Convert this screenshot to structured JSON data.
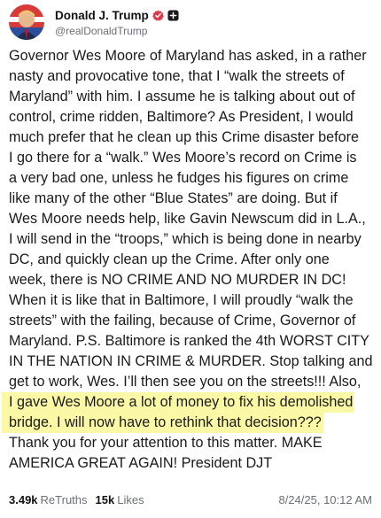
{
  "author": {
    "display_name": "Donald J. Trump",
    "handle": "@realDonaldTrump",
    "verified_icon": "verified-badge-icon",
    "follow_icon": "plus-square-icon",
    "avatar": "profile-avatar"
  },
  "post": {
    "lines": [
      "Governor Wes Moore of Maryland has asked, in a rather",
      "nasty and provocative tone, that I “walk the streets of",
      "Maryland” with him. I assume he is talking about out of",
      "control, crime ridden, Baltimore? As President, I would",
      "much prefer that he clean up this Crime disaster before",
      "I go there for a “walk.” Wes Moore’s record on Crime is",
      "a very bad one, unless he fudges his figures on crime",
      "like many of the other “Blue States” are doing. But if",
      "Wes Moore needs help, like Gavin Newscum did in L.A.,",
      "I will send in the “troops,” which is being done in nearby",
      "DC, and quickly clean up the Crime. After only one",
      "week, there is NO CRIME AND NO MURDER IN DC!",
      "When it is like that in Baltimore, I will proudly “walk the",
      "streets” with the failing, because of Crime, Governor of",
      "Maryland. P.S. Baltimore is ranked the 4th WORST CITY",
      "IN THE NATION IN CRIME & MURDER. Stop talking and",
      "get to work, Wes. I’ll then see you on the streets!!! Also,",
      "I gave Wes Moore a lot of money to fix his demolished",
      "bridge. I will now have to rethink that decision???",
      "Thank you for your attention to this matter. MAKE",
      "AMERICA GREAT AGAIN! President DJT"
    ],
    "highlight_color": "#fcf9a6"
  },
  "stats": {
    "retruths_count": "3.49k",
    "retruths_label": "ReTruths",
    "likes_count": "15k",
    "likes_label": "Likes",
    "timestamp": "8/24/25, 10:12 AM"
  },
  "colors": {
    "verified": "#e0394a",
    "muted_text": "#6b6f76"
  }
}
